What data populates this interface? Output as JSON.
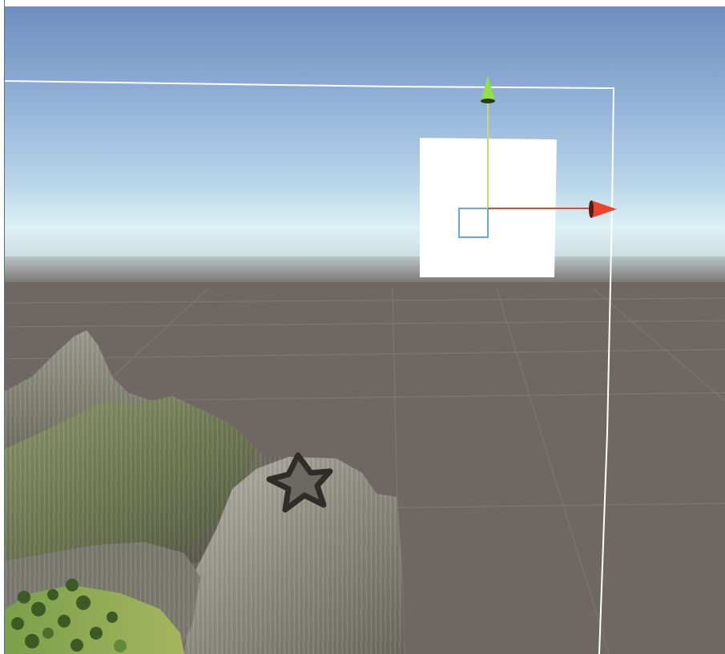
{
  "scene": {
    "view": "scene-view",
    "colors": {
      "sky_top": "#6f8ebf",
      "sky_mid": "#a9c6e4",
      "horizon": "#d9eef2",
      "ground": "#6f6763",
      "grid_line": "#8a827d",
      "canvas_outline": "#ffffff",
      "ui_panel": "#ffffff",
      "rect_handle": "#6aa6e0",
      "axis_y": "#8fe04a",
      "axis_x": "#e8452c"
    },
    "objects": [
      {
        "name": "terrain",
        "type": "mountains"
      },
      {
        "name": "star-carving",
        "type": "star"
      },
      {
        "name": "ui-image-panel",
        "type": "rect"
      }
    ],
    "gizmo": {
      "axes": [
        "y-axis",
        "x-axis"
      ],
      "pivot_icon": "rect-pivot-icon"
    }
  }
}
